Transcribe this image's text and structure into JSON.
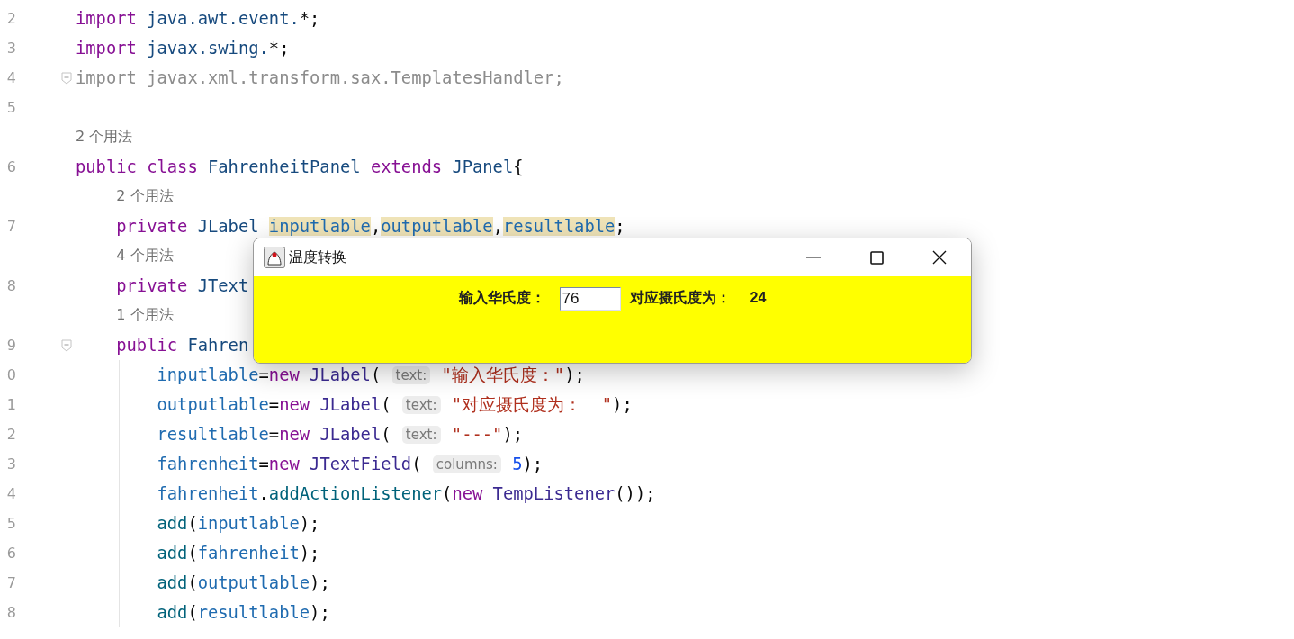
{
  "editor": {
    "lines": [
      {
        "kind": "code",
        "number": "2",
        "tokens": [
          {
            "text": "import",
            "kind": "keyword"
          },
          {
            "text": " java.awt.event.",
            "kind": "ident"
          },
          {
            "text": "*;",
            "kind": "plain"
          }
        ]
      },
      {
        "kind": "code",
        "number": "3",
        "tokens": [
          {
            "text": "import",
            "kind": "keyword"
          },
          {
            "text": " javax.swing.",
            "kind": "ident"
          },
          {
            "text": "*;",
            "kind": "plain"
          }
        ]
      },
      {
        "kind": "code",
        "number": "4",
        "fold": true,
        "tokens": [
          {
            "text": "import javax.xml.transform.sax.TemplatesHandler;",
            "kind": "unused"
          }
        ]
      },
      {
        "kind": "code",
        "number": "5"
      },
      {
        "kind": "hint",
        "text": "2 个用法"
      },
      {
        "kind": "code",
        "number": "6",
        "tokens": [
          {
            "text": "public class",
            "kind": "keyword"
          },
          {
            "text": " FahrenheitPanel ",
            "kind": "ident"
          },
          {
            "text": "extends",
            "kind": "keyword"
          },
          {
            "text": " JPanel",
            "kind": "ident"
          },
          {
            "text": "{",
            "kind": "plain"
          }
        ]
      },
      {
        "kind": "hint",
        "text": "2 个用法"
      },
      {
        "kind": "code",
        "number": "7",
        "tokens": [
          {
            "text": "    private",
            "kind": "keyword"
          },
          {
            "text": " JLabel ",
            "kind": "ident"
          },
          {
            "text": "inputlable",
            "kind": "marked"
          },
          {
            "text": ",",
            "kind": "plain"
          },
          {
            "text": "outputlable",
            "kind": "marked"
          },
          {
            "text": ",",
            "kind": "plain"
          },
          {
            "text": "resultlable",
            "kind": "marked"
          },
          {
            "text": ";",
            "kind": "plain"
          }
        ]
      },
      {
        "kind": "hint",
        "text": "4 个用法"
      },
      {
        "kind": "code",
        "number": "8",
        "tokens": [
          {
            "text": "    private",
            "kind": "keyword"
          },
          {
            "text": " JText",
            "kind": "ident"
          }
        ]
      },
      {
        "kind": "hint",
        "text": "1 个用法"
      },
      {
        "kind": "code",
        "number": "9",
        "fold": true,
        "tokens": [
          {
            "text": "    public",
            "kind": "keyword"
          },
          {
            "text": " Fahren",
            "kind": "ident"
          }
        ]
      },
      {
        "kind": "code",
        "number": "0",
        "tokens": [
          {
            "text": "        inputlable",
            "kind": "field"
          },
          {
            "text": "=",
            "kind": "plain"
          },
          {
            "text": "new",
            "kind": "keyword"
          },
          {
            "text": " JLabel",
            "kind": "cls"
          },
          {
            "text": "( ",
            "kind": "plain"
          },
          {
            "text": "text:",
            "kind": "param"
          },
          {
            "text": " \"输入华氏度：\"",
            "kind": "string"
          },
          {
            "text": ");",
            "kind": "plain"
          }
        ]
      },
      {
        "kind": "code",
        "number": "1",
        "tokens": [
          {
            "text": "        outputlable",
            "kind": "field"
          },
          {
            "text": "=",
            "kind": "plain"
          },
          {
            "text": "new",
            "kind": "keyword"
          },
          {
            "text": " JLabel",
            "kind": "cls"
          },
          {
            "text": "( ",
            "kind": "plain"
          },
          {
            "text": "text:",
            "kind": "param"
          },
          {
            "text": " \"对应摄氏度为：  \"",
            "kind": "string"
          },
          {
            "text": ");",
            "kind": "plain"
          }
        ]
      },
      {
        "kind": "code",
        "number": "2",
        "tokens": [
          {
            "text": "        resultlable",
            "kind": "field"
          },
          {
            "text": "=",
            "kind": "plain"
          },
          {
            "text": "new",
            "kind": "keyword"
          },
          {
            "text": " JLabel",
            "kind": "cls"
          },
          {
            "text": "( ",
            "kind": "plain"
          },
          {
            "text": "text:",
            "kind": "param"
          },
          {
            "text": " \"---\"",
            "kind": "string"
          },
          {
            "text": ");",
            "kind": "plain"
          }
        ]
      },
      {
        "kind": "code",
        "number": "3",
        "tokens": [
          {
            "text": "        fahrenheit",
            "kind": "field"
          },
          {
            "text": "=",
            "kind": "plain"
          },
          {
            "text": "new",
            "kind": "keyword"
          },
          {
            "text": " JTextField",
            "kind": "cls"
          },
          {
            "text": "( ",
            "kind": "plain"
          },
          {
            "text": "columns:",
            "kind": "param"
          },
          {
            "text": " 5",
            "kind": "number"
          },
          {
            "text": ");",
            "kind": "plain"
          }
        ]
      },
      {
        "kind": "code",
        "number": "4",
        "tokens": [
          {
            "text": "        fahrenheit",
            "kind": "field"
          },
          {
            "text": ".",
            "kind": "plain"
          },
          {
            "text": "addActionListener",
            "kind": "method"
          },
          {
            "text": "(",
            "kind": "plain"
          },
          {
            "text": "new",
            "kind": "keyword"
          },
          {
            "text": " TempListener",
            "kind": "cls"
          },
          {
            "text": "());",
            "kind": "plain"
          }
        ]
      },
      {
        "kind": "code",
        "number": "5",
        "tokens": [
          {
            "text": "        add",
            "kind": "method"
          },
          {
            "text": "(",
            "kind": "plain"
          },
          {
            "text": "inputlable",
            "kind": "field"
          },
          {
            "text": ");",
            "kind": "plain"
          }
        ]
      },
      {
        "kind": "code",
        "number": "6",
        "tokens": [
          {
            "text": "        add",
            "kind": "method"
          },
          {
            "text": "(",
            "kind": "plain"
          },
          {
            "text": "fahrenheit",
            "kind": "field"
          },
          {
            "text": ");",
            "kind": "plain"
          }
        ]
      },
      {
        "kind": "code",
        "number": "7",
        "tokens": [
          {
            "text": "        add",
            "kind": "method"
          },
          {
            "text": "(",
            "kind": "plain"
          },
          {
            "text": "outputlable",
            "kind": "field"
          },
          {
            "text": ");",
            "kind": "plain"
          }
        ]
      },
      {
        "kind": "code",
        "number": "8",
        "tokens": [
          {
            "text": "        add",
            "kind": "method"
          },
          {
            "text": "(",
            "kind": "plain"
          },
          {
            "text": "resultlable",
            "kind": "field"
          },
          {
            "text": ");",
            "kind": "plain"
          }
        ]
      }
    ]
  },
  "dialog": {
    "title": "温度转换",
    "input_label": "输入华氏度：",
    "input_value": "76",
    "output_label": "对应摄氏度为：",
    "result": "24"
  }
}
